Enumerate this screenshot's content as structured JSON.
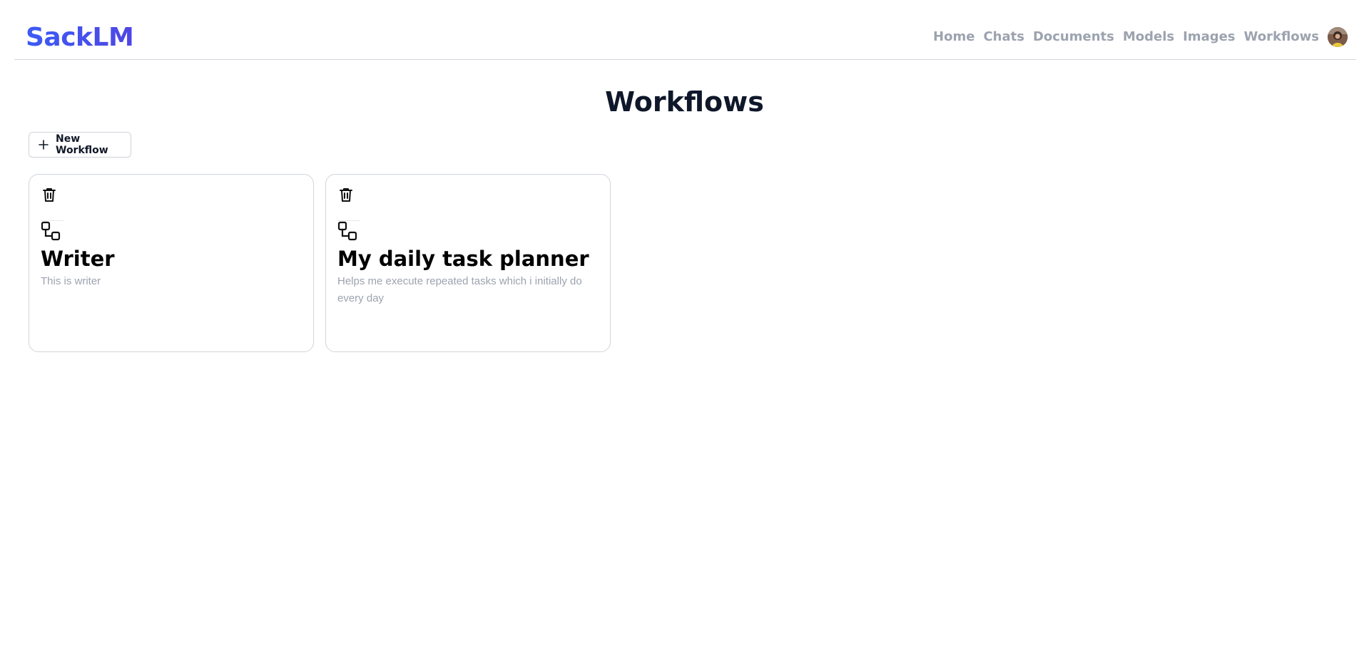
{
  "app": {
    "brand": "SackLM"
  },
  "nav": {
    "items": [
      {
        "label": "Home"
      },
      {
        "label": "Chats"
      },
      {
        "label": "Documents"
      },
      {
        "label": "Models"
      },
      {
        "label": "Images"
      },
      {
        "label": "Workflows"
      }
    ]
  },
  "page": {
    "title": "Workflows",
    "new_button_label": "New Workflow"
  },
  "workflows": [
    {
      "title": "Writer",
      "description": "This is writer"
    },
    {
      "title": "My daily task planner",
      "description": "Helps me execute repeated tasks which i initially do every day"
    }
  ],
  "colors": {
    "brand_start": "#3b5bf5",
    "brand_end": "#4f46e5",
    "nav_text": "#9ca3af",
    "border": "#d1d5db"
  },
  "icons": {
    "new_button": "plus-icon",
    "card_delete": "trash-icon",
    "card_type": "workflow-icon"
  }
}
